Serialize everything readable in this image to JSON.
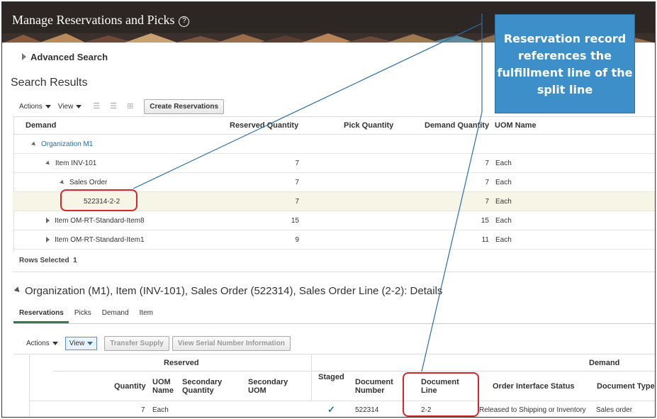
{
  "header": {
    "title": "Manage Reservations and Picks",
    "help_icon": "help-circle-icon"
  },
  "advanced_search": {
    "label": "Advanced Search"
  },
  "search_results": {
    "title": "Search Results",
    "toolbar": {
      "actions_label": "Actions",
      "view_label": "View",
      "create_button": "Create Reservations"
    },
    "columns": {
      "demand": "Demand",
      "reserved_quantity": "Reserved Quantity",
      "pick_quantity": "Pick Quantity",
      "demand_quantity": "Demand Quantity",
      "uom_name": "UOM Name"
    },
    "rows": [
      {
        "label": "Organization M1",
        "reserved": "",
        "demand": "",
        "uom": ""
      },
      {
        "label": "Item INV-101",
        "reserved": "7",
        "demand": "7",
        "uom": "Each"
      },
      {
        "label": "Sales Order",
        "reserved": "7",
        "demand": "7",
        "uom": "Each"
      },
      {
        "label": "522314-2-2",
        "reserved": "7",
        "demand": "7",
        "uom": "Each"
      },
      {
        "label": "Item OM-RT-Standard-Item8",
        "reserved": "15",
        "demand": "15",
        "uom": "Each"
      },
      {
        "label": "Item OM-RT-Standard-Item1",
        "reserved": "9",
        "demand": "11",
        "uom": "Each"
      }
    ],
    "rows_selected_label": "Rows Selected",
    "rows_selected_count": "1"
  },
  "details": {
    "title": "Organization (M1), Item (INV-101), Sales Order (522314), Sales Order Line (2-2): Details",
    "tabs": [
      "Reservations",
      "Picks",
      "Demand",
      "Item"
    ],
    "toolbar": {
      "actions_label": "Actions",
      "view_label": "View",
      "transfer_supply": "Transfer Supply",
      "view_serial": "View Serial Number Information"
    },
    "groups": {
      "reserved": "Reserved",
      "demand": "Demand"
    },
    "columns": {
      "quantity": "Quantity",
      "uom_name": "UOM Name",
      "secondary_quantity": "Secondary Quantity",
      "secondary_uom": "Secondary UOM",
      "staged": "Staged",
      "document_number": "Document Number",
      "document_line": "Document Line",
      "order_interface_status": "Order Interface Status",
      "document_type": "Document Type"
    },
    "row": {
      "quantity": "7",
      "uom_name": "Each",
      "staged": "✓",
      "document_number": "522314",
      "document_line": "2-2",
      "order_interface_status": "Released to Shipping or Inventory",
      "document_type": "Sales order"
    }
  },
  "callout": {
    "text": "Reservation record references the fulfillment line of the split line"
  },
  "colors": {
    "banner": "#2c2624",
    "callout": "#3d8fc9",
    "highlight": "#d6262b",
    "link": "#2a6fa8"
  }
}
